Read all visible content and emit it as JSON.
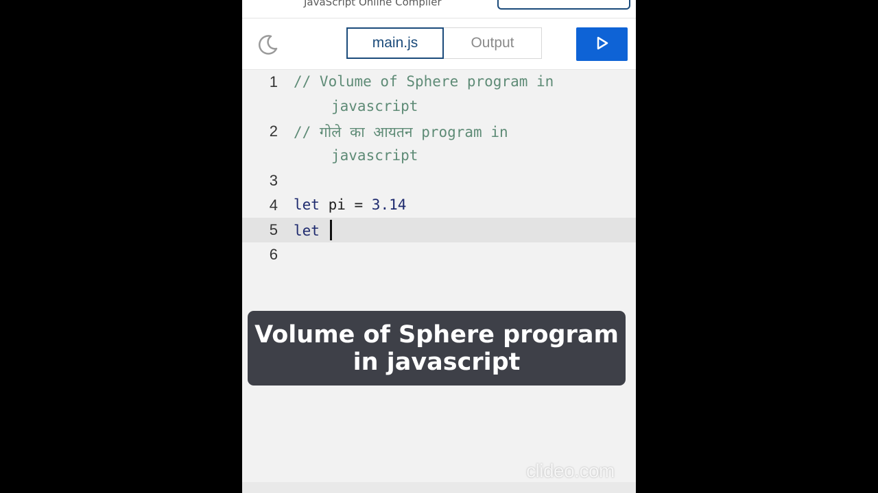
{
  "app": {
    "title": "JavaScript Online Compiler"
  },
  "toolbar": {
    "theme_icon": "moon-icon",
    "tabs": [
      {
        "label": "main.js",
        "active": true
      },
      {
        "label": "Output",
        "active": false
      }
    ],
    "run_icon": "play-icon",
    "run_color": "#0e63d6"
  },
  "editor": {
    "lines": [
      {
        "number": "1",
        "text": "// Volume of Sphere program in",
        "continuation": "javascript"
      },
      {
        "number": "2",
        "text": "// गोले का आयतन program in",
        "continuation": "javascript"
      },
      {
        "number": "3",
        "text": ""
      },
      {
        "number": "4",
        "keyword": "let",
        "rest_ident": " pi = ",
        "rest_num": "3.14"
      },
      {
        "number": "5",
        "keyword": "let",
        "rest_ident": " ",
        "active": true
      },
      {
        "number": "6",
        "text": ""
      }
    ]
  },
  "caption": {
    "text": "Volume of Sphere program in javascript"
  },
  "watermark": {
    "text": "clideo.com"
  },
  "colors": {
    "accent": "#1a4a7a",
    "comment": "#5e8b76",
    "keyword": "#1e2a6e",
    "caption_bg": "#3e4048"
  }
}
